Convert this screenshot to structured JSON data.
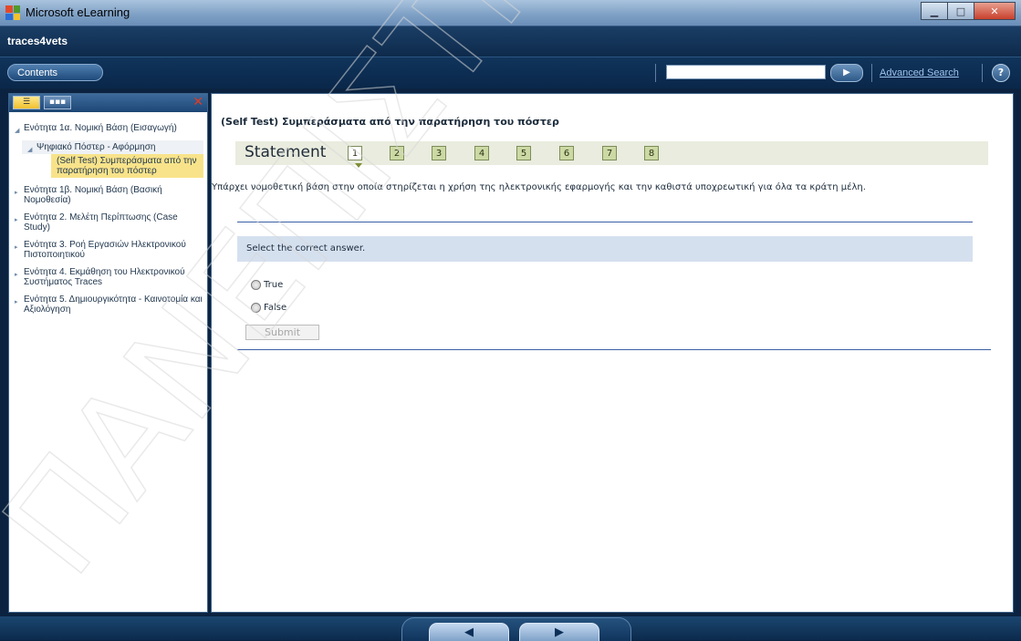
{
  "window": {
    "title": "Microsoft eLearning",
    "minimize": "▁",
    "maximize": "□",
    "close": "✕"
  },
  "app": {
    "brand": "traces4vets"
  },
  "toolbar": {
    "contents_label": "Contents",
    "search_value": "",
    "go_icon": "▶",
    "advanced_search_label": "Advanced Search",
    "help_label": "?"
  },
  "sidebar": {
    "tab_toc_icon": "list-icon",
    "tab_grid_icon": "grid-icon",
    "close_label": "✕",
    "items": [
      {
        "label": "Ενότητα 1α. Νομική Βάση (Εισαγωγή)",
        "arrow": "◢"
      },
      {
        "label": "Ψηφιακό Πόστερ - Αφόρμηση",
        "arrow": "◢"
      },
      {
        "label": "(Self Test) Συμπεράσματα από την παρατήρηση του πόστερ",
        "arrow": ""
      },
      {
        "label": "Ενότητα 1β. Νομική Βάση (Βασική Νομοθεσία)",
        "arrow": "▸"
      },
      {
        "label": "Ενότητα 2. Μελέτη Περίπτωσης (Case Study)",
        "arrow": "▸"
      },
      {
        "label": "Ενότητα 3. Ροή Εργασιών Ηλεκτρονικού Πιστοποιητικού",
        "arrow": "▸"
      },
      {
        "label": "Ενότητα 4. Εκμάθηση του Ηλεκτρονικού Συστήματος Traces",
        "arrow": "▸"
      },
      {
        "label": "Ενότητα 5. Δημιουργικότητα - Καινοτομία και Αξιολόγηση",
        "arrow": "▸"
      }
    ]
  },
  "main": {
    "title": "(Self Test) Συμπεράσματα από την παρατήρηση του πόστερ",
    "statement_label": "Statement",
    "pages": [
      "1",
      "2",
      "3",
      "4",
      "5",
      "6",
      "7",
      "8"
    ],
    "current_page": "1",
    "question": "Υπάρχει νομοθετική βάση στην οποία στηρίζεται η χρήση της ηλεκτρονικής εφαρμογής και την καθιστά υποχρεωτική για όλα τα κράτη μέλη.",
    "instruction": "Select the correct answer.",
    "options": [
      "True",
      "False"
    ],
    "submit_label": "Submit"
  },
  "footer": {
    "prev_label": "◀",
    "next_label": "▶"
  },
  "watermark": {
    "text": "ΠΑΝΕΠΙΣΤΗΜΙΟ",
    "color": "#e8e8e8"
  }
}
